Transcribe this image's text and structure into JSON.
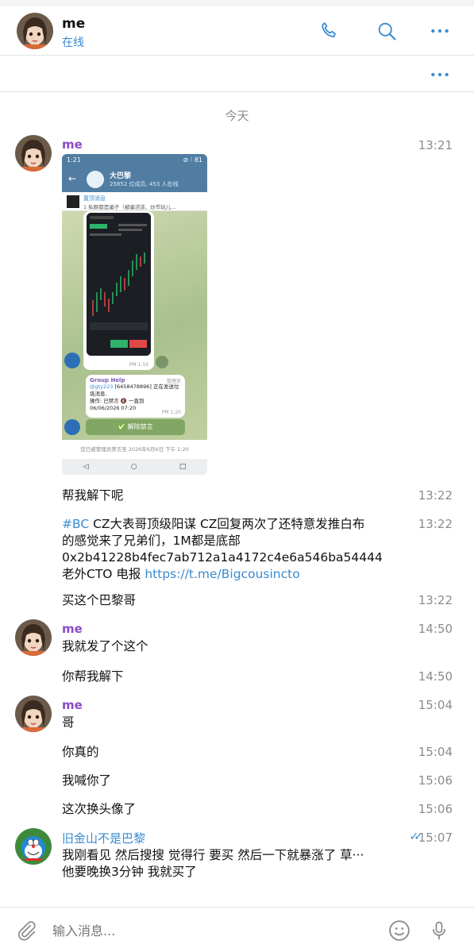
{
  "header": {
    "title": "me",
    "status": "在线",
    "call_icon": "phone-icon",
    "search_icon": "search-icon",
    "menu_icon": "more-icon"
  },
  "subbar": {
    "menu_icon": "more-icon"
  },
  "date_separator": "今天",
  "messages": [
    {
      "sender": "me",
      "time": "13:21",
      "type": "image"
    },
    {
      "text": "帮我解下呢",
      "time": "13:22"
    },
    {
      "hashtag": "#BC",
      "text_line1": " CZ大表哥顶级阳谋 CZ回复两次了还特意发推白布",
      "text_line2": "的感觉来了兄弟们，1M都是底部",
      "text_line3": "0x2b41228b4fec7ab712a1a4172c4e6a546ba54444",
      "text_line4_prefix": "老外CTO 电报 ",
      "link": "https://t.me/Bigcousincto",
      "time": "13:22"
    },
    {
      "text": "买这个巴黎哥",
      "time": "13:22"
    },
    {
      "sender": "me",
      "text": "我就发了个这个",
      "time": "14:50"
    },
    {
      "text": "你帮我解下",
      "time": "14:50"
    },
    {
      "sender": "me",
      "text": "哥",
      "time": "15:04"
    },
    {
      "text": "你真的",
      "time": "15:04"
    },
    {
      "text": "我喊你了",
      "time": "15:06"
    },
    {
      "text": "这次换头像了",
      "time": "15:06"
    },
    {
      "sender": "旧金山不是巴黎",
      "line1": "我刚看见 然后搜搜 觉得行 要买 然后一下就暴涨了 草···",
      "line2": "他要晚换3分钟 我就买了",
      "time": "15:07",
      "status": "read"
    }
  ],
  "screenshot": {
    "status_time": "1:21",
    "status_right": "⊘ ⁝ 81",
    "group_name": "大巴黎",
    "group_sub": "25852 位成员, 453 人在线",
    "pinned_title": "置顶消息",
    "pinned_text": "1 私聊都是骗子（被骗活该、炒币玩儿...",
    "msg_time1": "PM 1:19",
    "bot_name": "Group Help",
    "bot_admin": "管理员",
    "bot_user": "@gty223",
    "bot_text1": " [6458478896] 正在发送垃圾消息.",
    "bot_text2": "操作:  已禁言 🔇 一直到",
    "bot_text3": "06/06/2026 07:20",
    "msg_time2": "PM 1:20",
    "unban_label": "✅ 解除禁言",
    "footer": "您已被管理员禁言至 2026年6月6日 下午 1:20",
    "nav": [
      "◁",
      "○",
      "□"
    ]
  },
  "composer": {
    "placeholder": "输入消息...",
    "attach_icon": "paperclip-icon",
    "emoji_icon": "emoji-icon",
    "mic_icon": "microphone-icon"
  },
  "colors": {
    "accent": "#3a8bd0",
    "sender_purple": "#8a4cc7",
    "time_gray": "#8b8b8b"
  }
}
